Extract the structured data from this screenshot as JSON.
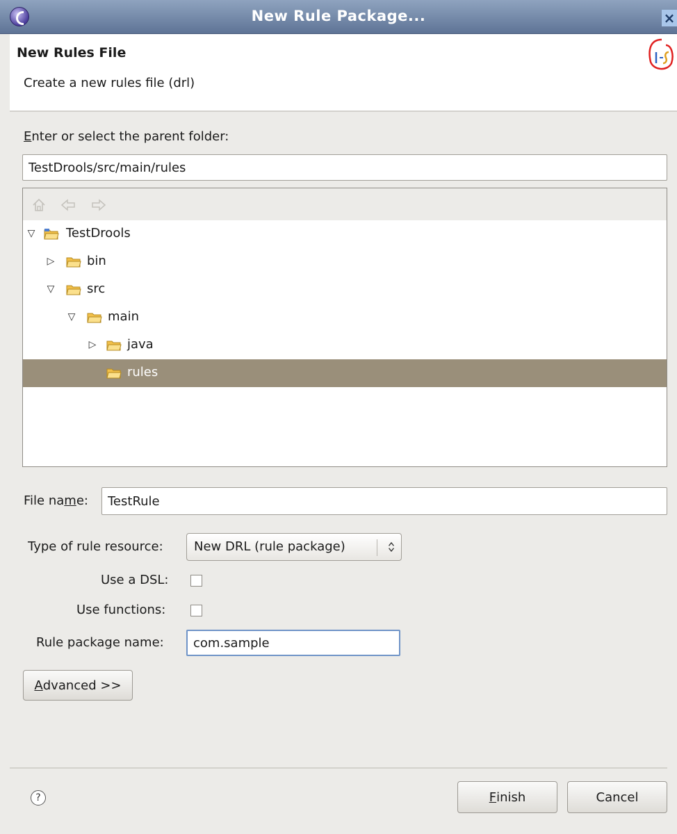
{
  "window": {
    "title": "New Rule Package...",
    "close_symbol": "×"
  },
  "header": {
    "title": "New Rules File",
    "description": "Create a new rules file (drl)"
  },
  "folder_section": {
    "label_first": "E",
    "label_rest": "nter or select the parent folder:",
    "path_value": "TestDrools/src/main/rules",
    "nav_icons": [
      "home-icon",
      "back-icon",
      "forward-icon"
    ],
    "tree": [
      {
        "label": "TestDrools",
        "expanded": true
      },
      {
        "label": "bin",
        "expanded": false
      },
      {
        "label": "src",
        "expanded": true
      },
      {
        "label": "main",
        "expanded": true
      },
      {
        "label": "java",
        "expanded": false
      },
      {
        "label": "rules",
        "selected": true
      }
    ]
  },
  "file_name": {
    "label_a": "File na",
    "label_mnemonic": "m",
    "label_b": "e:",
    "value": "TestRule"
  },
  "options": {
    "type_label": "Type of rule resource:",
    "type_value": "New DRL (rule package)",
    "use_dsl_label": "Use a DSL:",
    "use_dsl_checked": false,
    "use_functions_label": "Use functions:",
    "use_functions_checked": false,
    "package_label": "Rule package name:",
    "package_value": "com.sample"
  },
  "advanced_button": {
    "mnemonic": "A",
    "rest": "dvanced >>"
  },
  "footer": {
    "help_symbol": "?",
    "finish_mnemonic": "F",
    "finish_rest": "inish",
    "cancel_label": "Cancel"
  },
  "colors": {
    "title_bar": "#7086a8",
    "selection": "#9a8f7a",
    "folder": "#f2c04a"
  }
}
